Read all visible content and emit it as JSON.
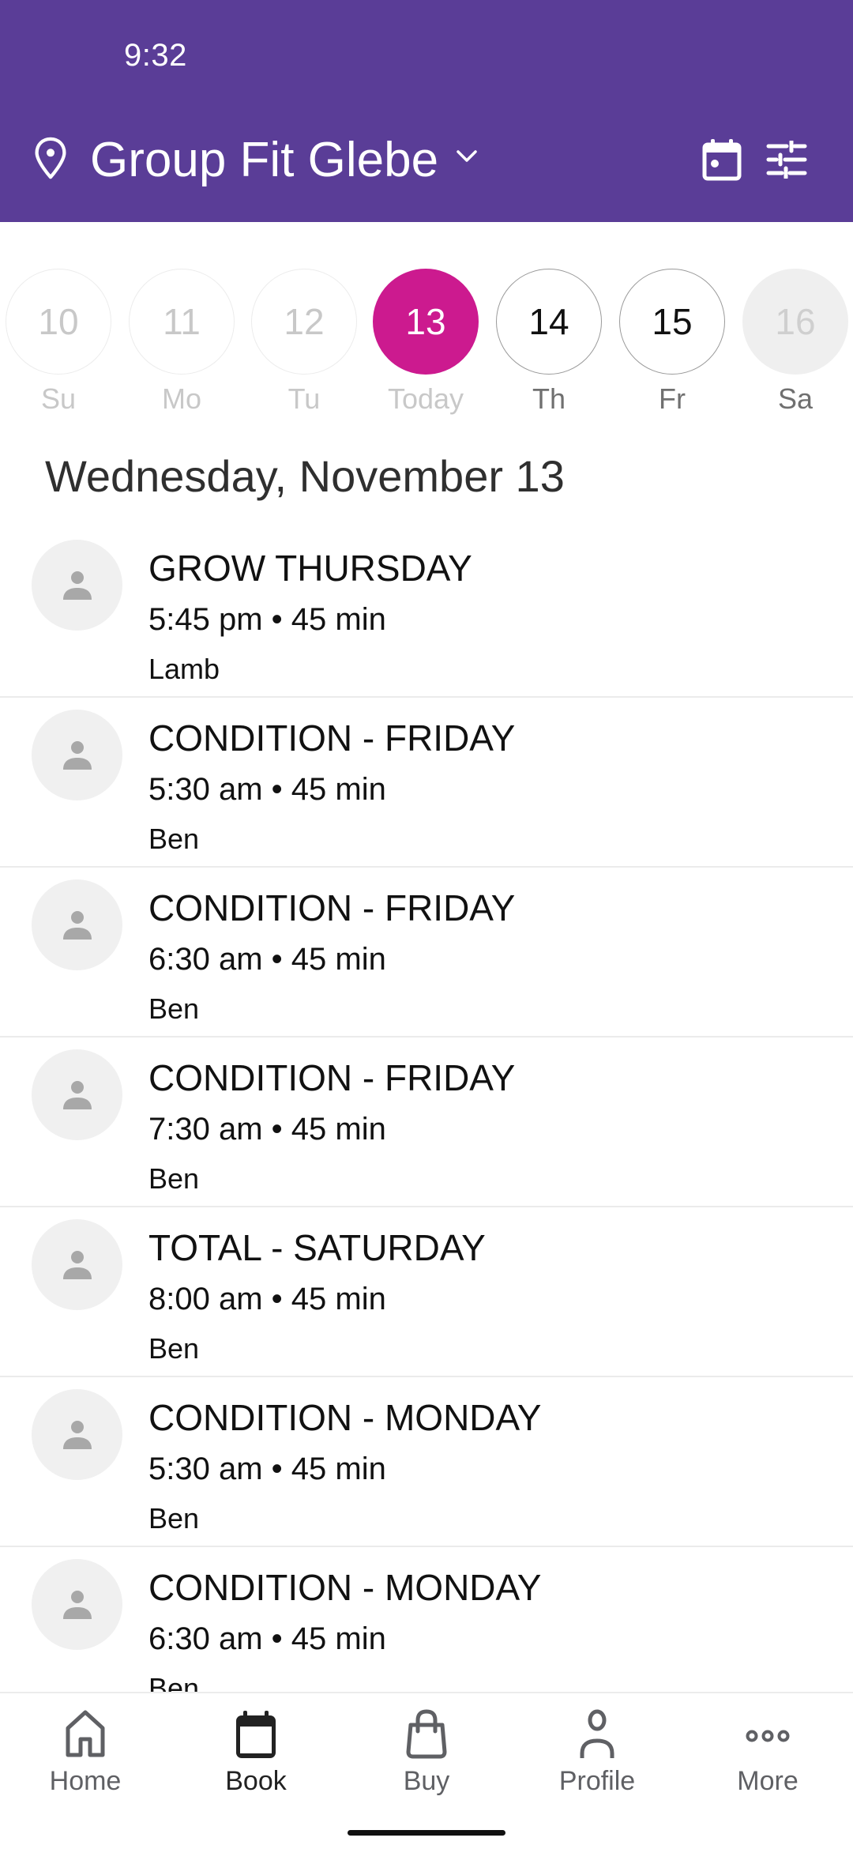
{
  "status_bar": {
    "time": "9:32"
  },
  "header": {
    "location_icon": "map-pin-icon",
    "location": "Group Fit Glebe",
    "dropdown_icon": "chevron-down-icon",
    "actions": [
      {
        "name": "calendar-icon"
      },
      {
        "name": "filter-sliders-icon"
      }
    ],
    "background_color": "#5A3D97"
  },
  "date_strip": {
    "selected_color": "#CC1A8F",
    "days": [
      {
        "number": "10",
        "label": "Su",
        "state": "past"
      },
      {
        "number": "11",
        "label": "Mo",
        "state": "past"
      },
      {
        "number": "12",
        "label": "Tu",
        "state": "past"
      },
      {
        "number": "13",
        "label": "Today",
        "state": "selected"
      },
      {
        "number": "14",
        "label": "Th",
        "state": "future"
      },
      {
        "number": "15",
        "label": "Fr",
        "state": "future"
      },
      {
        "number": "16",
        "label": "Sa",
        "state": "unavailable"
      }
    ]
  },
  "date_heading": "Wednesday, November 13",
  "classes": [
    {
      "title": "GROW THURSDAY",
      "time": "5:45 pm • 45 min",
      "instructor": "Lamb"
    },
    {
      "title": "CONDITION - FRIDAY",
      "time": "5:30 am • 45 min",
      "instructor": "Ben"
    },
    {
      "title": "CONDITION - FRIDAY",
      "time": "6:30 am • 45 min",
      "instructor": "Ben"
    },
    {
      "title": "CONDITION - FRIDAY",
      "time": "7:30 am • 45 min",
      "instructor": "Ben"
    },
    {
      "title": "TOTAL - SATURDAY",
      "time": "8:00 am • 45 min",
      "instructor": "Ben"
    },
    {
      "title": "CONDITION - MONDAY",
      "time": "5:30 am • 45 min",
      "instructor": "Ben"
    },
    {
      "title": "CONDITION - MONDAY",
      "time": "6:30 am • 45 min",
      "instructor": "Ben"
    }
  ],
  "bottom_nav": {
    "items": [
      {
        "label": "Home",
        "icon": "home-icon",
        "active": false
      },
      {
        "label": "Book",
        "icon": "calendar-icon",
        "active": true
      },
      {
        "label": "Buy",
        "icon": "shopping-bag-icon",
        "active": false
      },
      {
        "label": "Profile",
        "icon": "person-icon",
        "active": false
      },
      {
        "label": "More",
        "icon": "more-dots-icon",
        "active": false
      }
    ]
  }
}
